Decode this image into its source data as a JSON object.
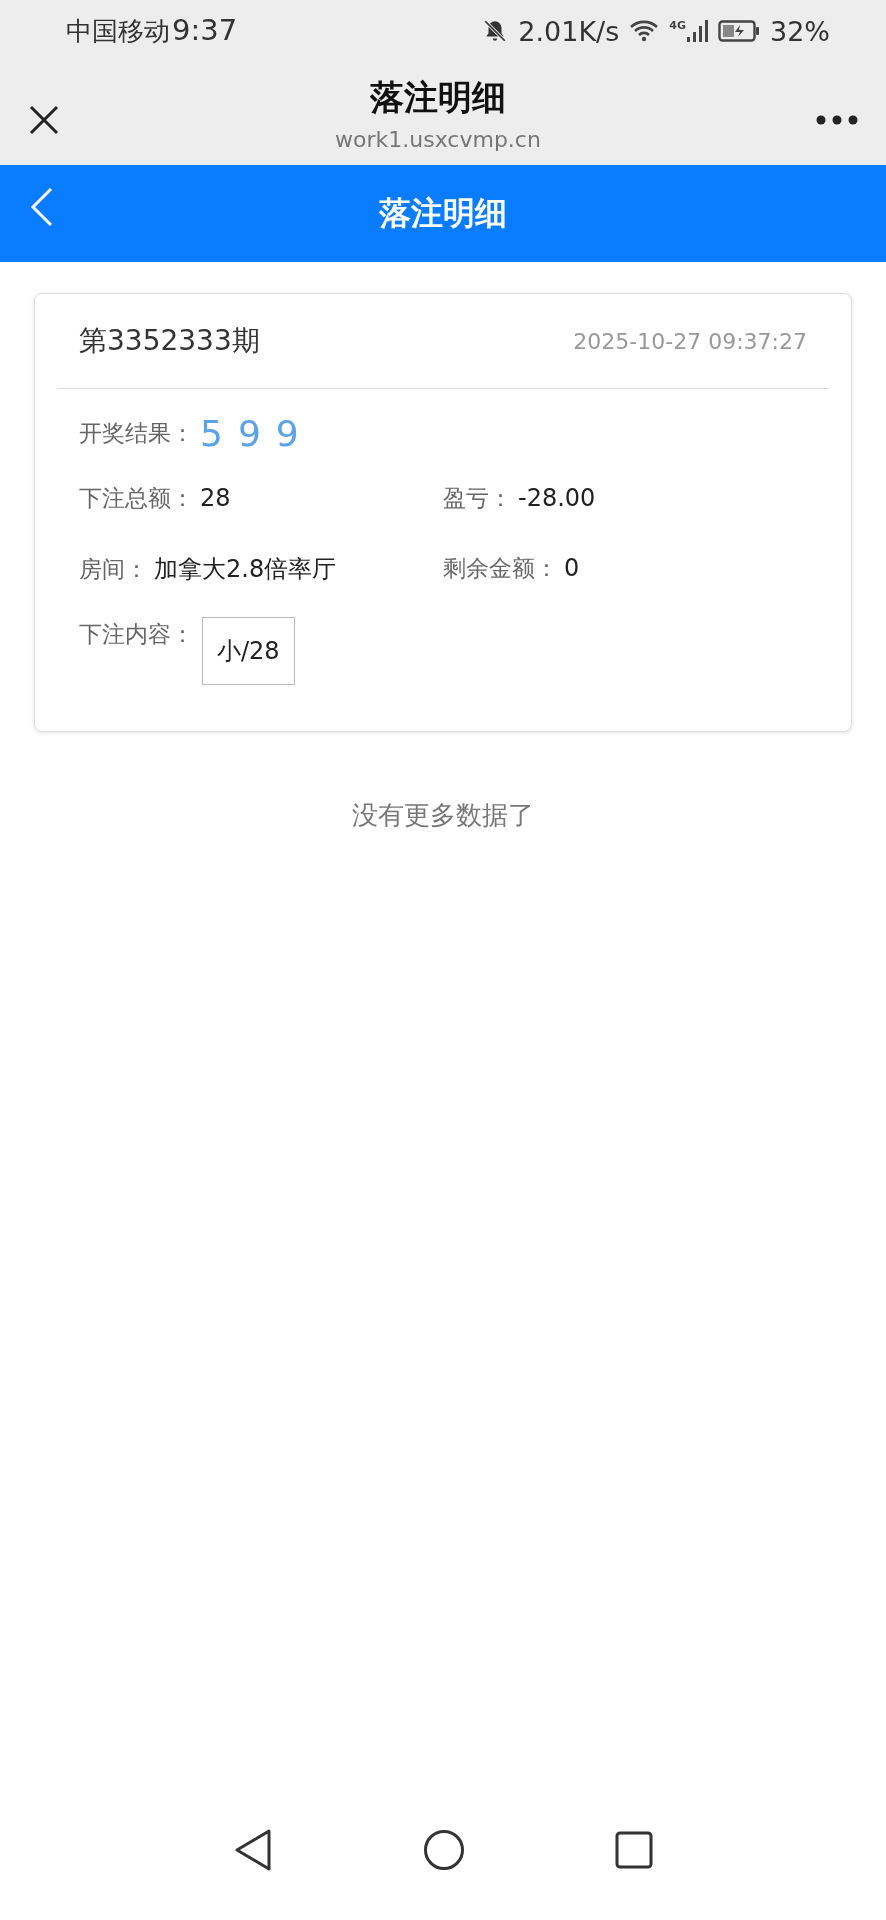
{
  "status_bar": {
    "carrier": "中国移动",
    "time": "9:37",
    "speed": "2.01K/s",
    "network": "4G",
    "battery": "32%"
  },
  "browser": {
    "title": "落注明细",
    "url": "work1.usxcvmp.cn"
  },
  "app_bar": {
    "title": "落注明细"
  },
  "card": {
    "issue": "第3352333期",
    "datetime": "2025-10-27 09:37:27",
    "result_label": "开奖结果：",
    "result": [
      "5",
      "9",
      "9"
    ],
    "fields": [
      {
        "label": "下注总额：",
        "value": "28"
      },
      {
        "label": "盈亏：",
        "value": "-28.00"
      },
      {
        "label": "房间：",
        "value": "加拿大2.8倍率厅"
      },
      {
        "label": "剩余金额：",
        "value": "0"
      }
    ],
    "bet_label": "下注内容：",
    "bets": [
      "小/28"
    ]
  },
  "footer_note": "没有更多数据了"
}
